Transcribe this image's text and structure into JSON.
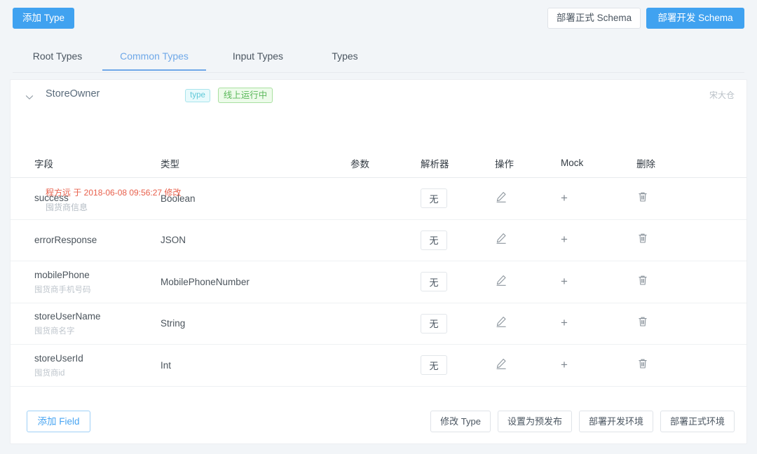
{
  "topbar": {
    "add_type_label": "添加 Type",
    "deploy_prod_schema_label": "部署正式 Schema",
    "deploy_dev_schema_label": "部署开发 Schema",
    "primary_color": "#40a2f0"
  },
  "tabs": {
    "active_index": 1,
    "items": [
      {
        "label": "Root Types"
      },
      {
        "label": "Common Types"
      },
      {
        "label": "Input Types"
      },
      {
        "label": "Types"
      }
    ],
    "active_color": "#6fa8e8"
  },
  "type_card": {
    "collapse_icon": "chevron-down-icon",
    "name": "StoreOwner",
    "kind_tag": "type",
    "status_tag": "线上运行中",
    "status_color": "#5ab85a",
    "modified_text": "程方远 于 2018-06-08 09:56:27 修改",
    "modified_color": "#e8604c",
    "description": "囤货商信息",
    "owner": "宋大仓"
  },
  "table": {
    "headers": {
      "field": "字段",
      "type": "类型",
      "param": "参数",
      "resolver": "解析器",
      "operation": "操作",
      "mock": "Mock",
      "delete": "删除"
    },
    "resolver_value": "无",
    "edit_icon": "pencil-icon",
    "mock_icon": "plus-icon",
    "delete_icon": "trash-icon",
    "rows": [
      {
        "field": "success",
        "sub": "",
        "type": "Boolean",
        "param": "",
        "resolver": "无"
      },
      {
        "field": "errorResponse",
        "sub": "",
        "type": "JSON",
        "param": "",
        "resolver": "无"
      },
      {
        "field": "mobilePhone",
        "sub": "囤货商手机号码",
        "type": "MobilePhoneNumber",
        "param": "",
        "resolver": "无"
      },
      {
        "field": "storeUserName",
        "sub": "囤货商名字",
        "type": "String",
        "param": "",
        "resolver": "无"
      },
      {
        "field": "storeUserId",
        "sub": "囤货商id",
        "type": "Int",
        "param": "",
        "resolver": "无"
      }
    ]
  },
  "footer": {
    "add_field_label": "添加 Field",
    "actions": [
      {
        "label": "修改 Type"
      },
      {
        "label": "设置为预发布"
      },
      {
        "label": "部署开发环境"
      },
      {
        "label": "部署正式环境"
      }
    ]
  }
}
